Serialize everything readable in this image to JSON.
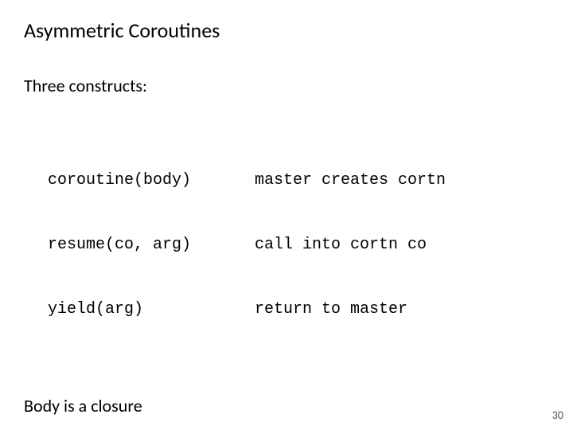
{
  "title": "Asymmetric Coroutines",
  "subhead": "Three constructs:",
  "constructs": {
    "left": [
      "coroutine(body)",
      "resume(co, arg)",
      "yield(arg)"
    ],
    "right": [
      "master creates cortn",
      "call into cortn co",
      "return to master"
    ]
  },
  "closing": "Body is a closure",
  "page_number": "30"
}
